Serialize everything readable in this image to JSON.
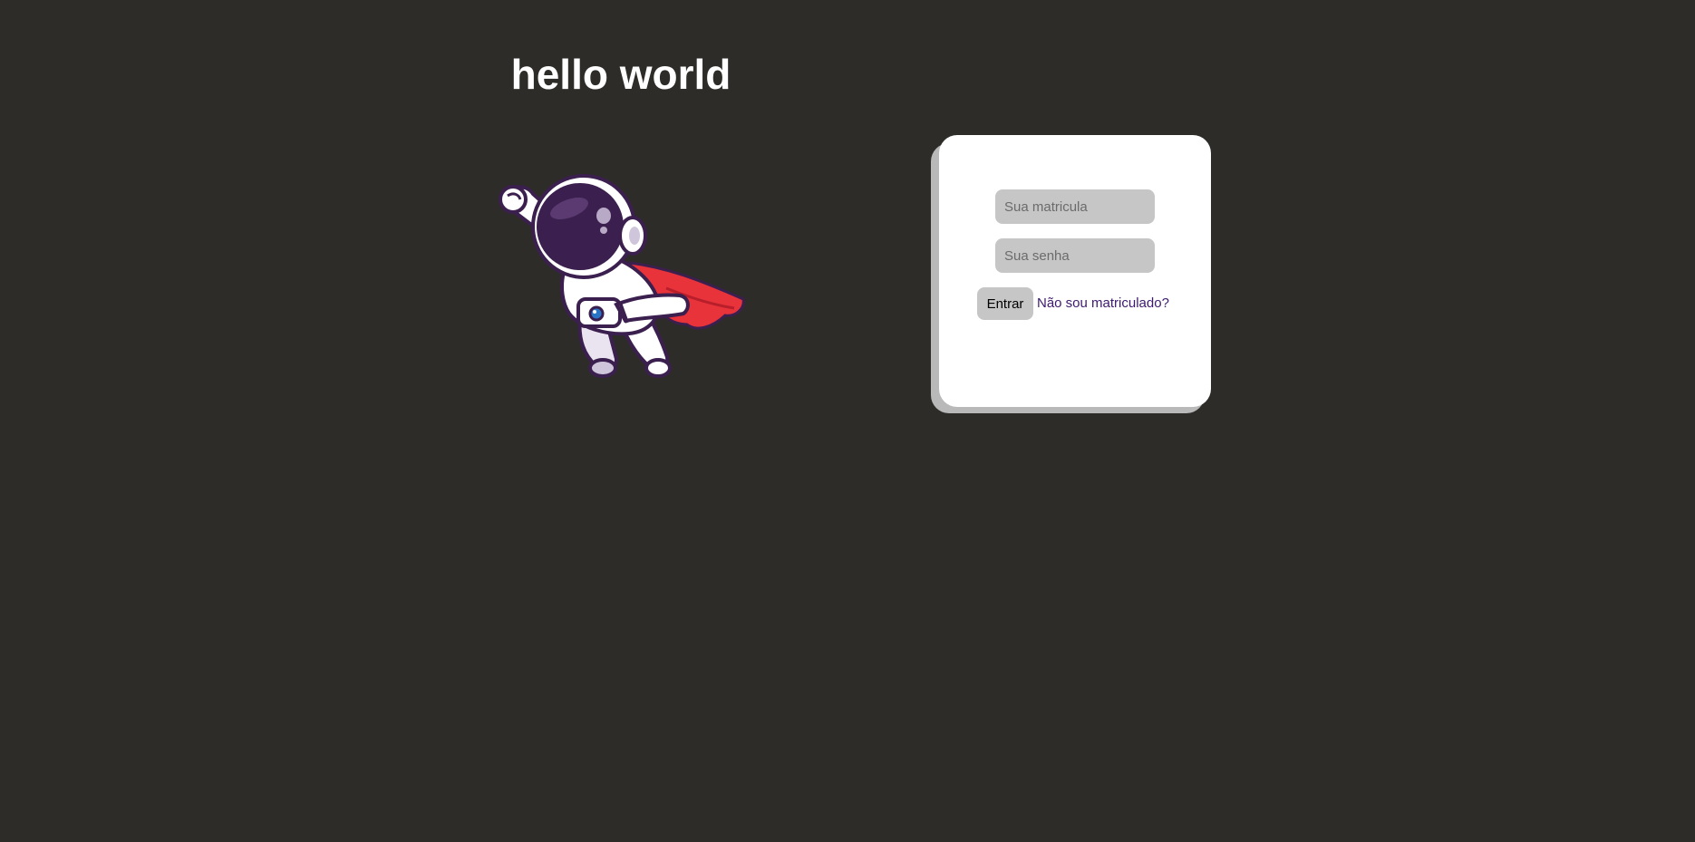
{
  "header": {
    "title": "hello world"
  },
  "illustration": {
    "icon": "flying-astronaut-with-red-cape"
  },
  "login_form": {
    "matricula_placeholder": "Sua matricula",
    "senha_placeholder": "Sua senha",
    "submit_label": "Entrar",
    "register_link_label": "Não sou matriculado?"
  },
  "colors": {
    "background": "#2e2c29",
    "card": "#ffffff",
    "card_shadow": "#b9b9b9",
    "input_fill": "#c6c6c6",
    "link": "#3d1a6e",
    "astronaut_visor": "#3b1f4e",
    "cape": "#e8333b"
  }
}
